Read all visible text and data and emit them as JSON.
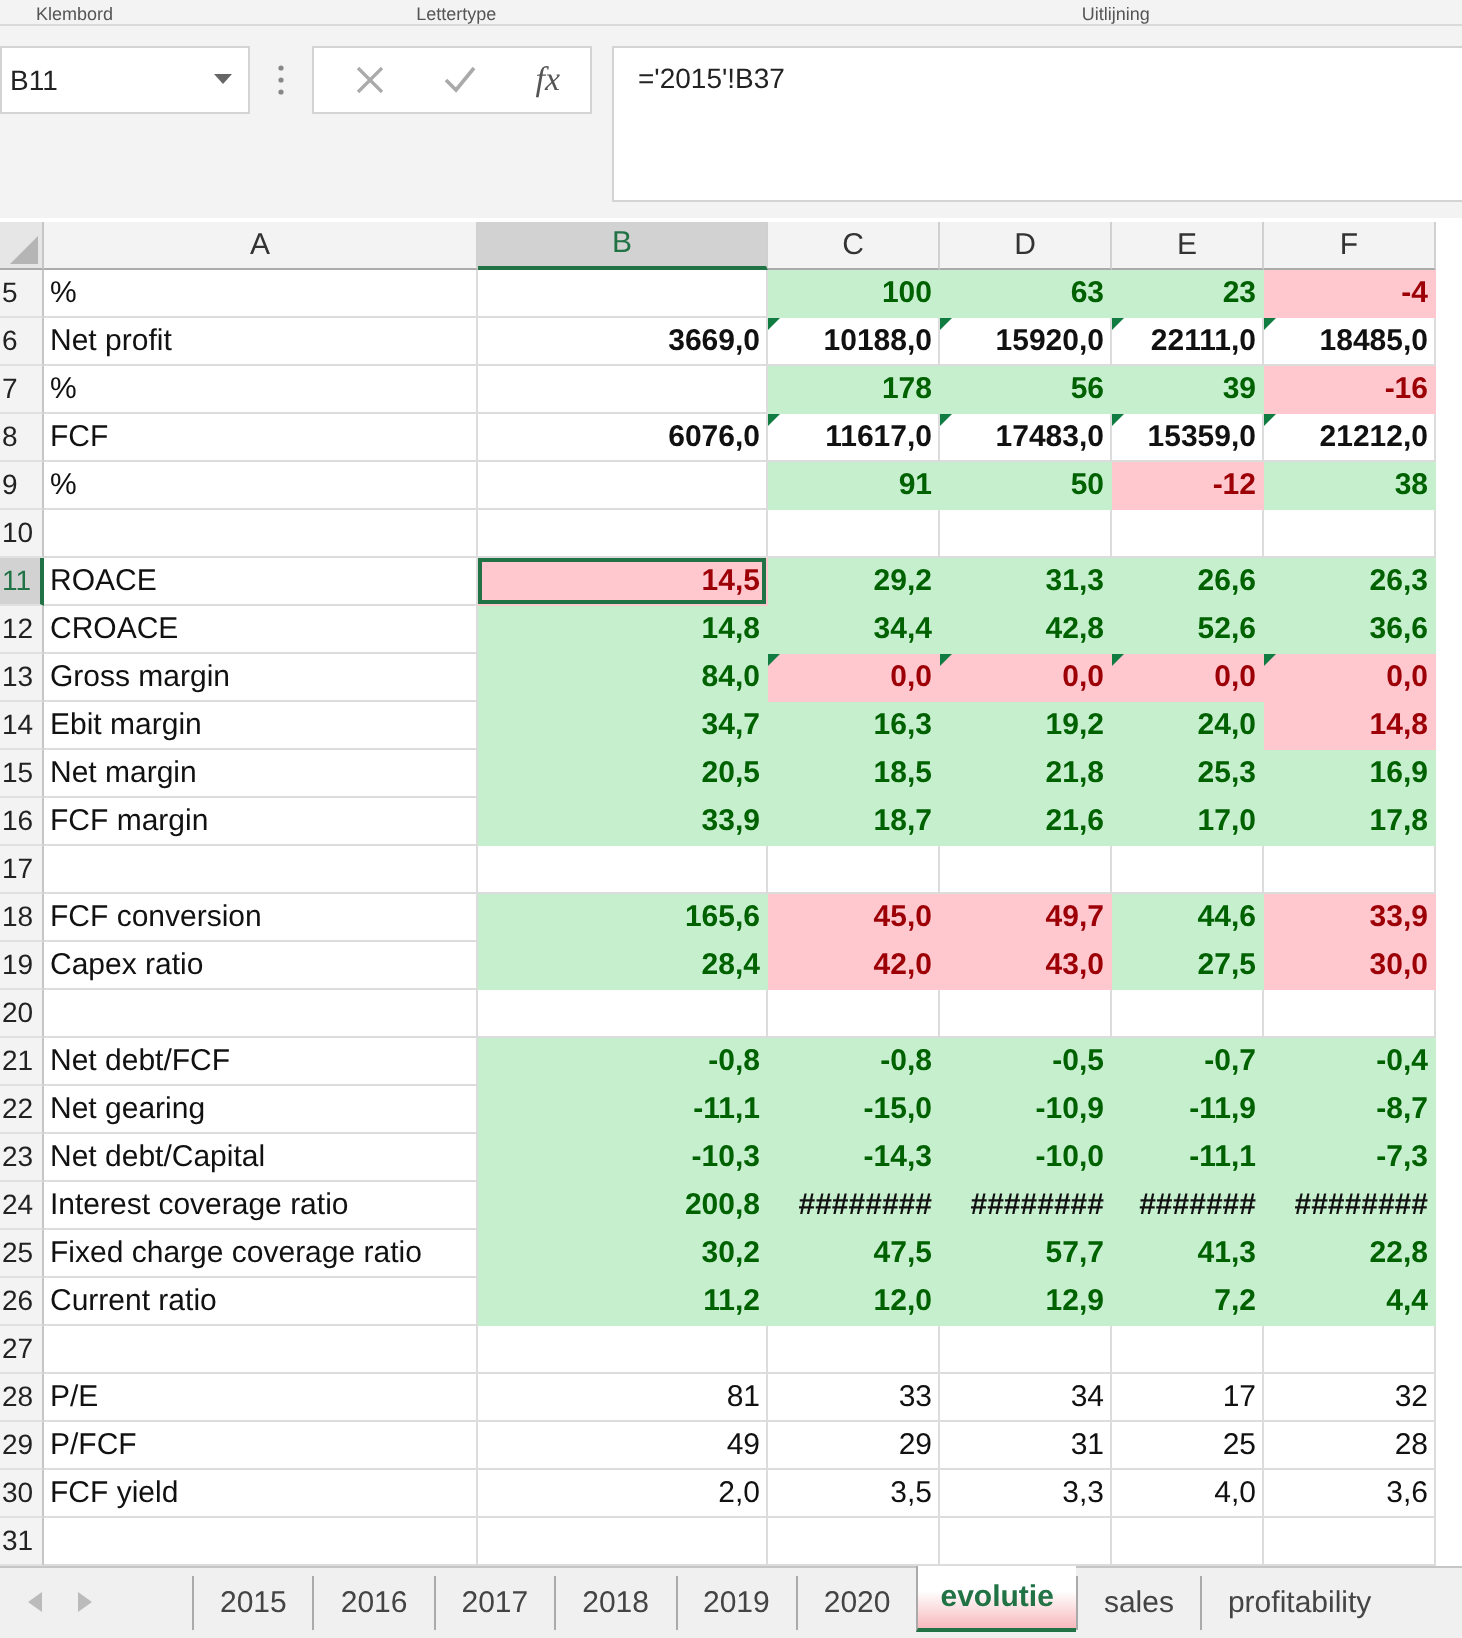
{
  "ribbon_groups": [
    "Klembord",
    "Lettertype",
    "Uitlijning"
  ],
  "formula_bar": {
    "name_box": "B11",
    "fx": "fx",
    "formula": "='2015'!B37"
  },
  "columns": [
    {
      "label": "A",
      "selected": false
    },
    {
      "label": "B",
      "selected": true
    },
    {
      "label": "C",
      "selected": false
    },
    {
      "label": "D",
      "selected": false
    },
    {
      "label": "E",
      "selected": false
    },
    {
      "label": "F",
      "selected": false
    }
  ],
  "rows": [
    {
      "num": "5",
      "label": "%",
      "selected": false,
      "bold": true,
      "cells": [
        null,
        {
          "text": "100",
          "kind": "good",
          "flag": false,
          "selected": false
        },
        {
          "text": "63",
          "kind": "good",
          "flag": false,
          "selected": false
        },
        {
          "text": "23",
          "kind": "good",
          "flag": false,
          "selected": false
        },
        {
          "text": "-4",
          "kind": "bad",
          "flag": false,
          "selected": false
        }
      ]
    },
    {
      "num": "6",
      "label": "Net profit",
      "selected": false,
      "bold": true,
      "cells": [
        {
          "text": "3669,0",
          "kind": "plain",
          "flag": false,
          "selected": false
        },
        {
          "text": "10188,0",
          "kind": "plain",
          "flag": true,
          "selected": false
        },
        {
          "text": "15920,0",
          "kind": "plain",
          "flag": true,
          "selected": false
        },
        {
          "text": "22111,0",
          "kind": "plain",
          "flag": true,
          "selected": false
        },
        {
          "text": "18485,0",
          "kind": "plain",
          "flag": true,
          "selected": false
        }
      ]
    },
    {
      "num": "7",
      "label": "%",
      "selected": false,
      "bold": true,
      "cells": [
        null,
        {
          "text": "178",
          "kind": "good",
          "flag": false,
          "selected": false
        },
        {
          "text": "56",
          "kind": "good",
          "flag": false,
          "selected": false
        },
        {
          "text": "39",
          "kind": "good",
          "flag": false,
          "selected": false
        },
        {
          "text": "-16",
          "kind": "bad",
          "flag": false,
          "selected": false
        }
      ]
    },
    {
      "num": "8",
      "label": "FCF",
      "selected": false,
      "bold": true,
      "cells": [
        {
          "text": "6076,0",
          "kind": "plain",
          "flag": false,
          "selected": false
        },
        {
          "text": "11617,0",
          "kind": "plain",
          "flag": true,
          "selected": false
        },
        {
          "text": "17483,0",
          "kind": "plain",
          "flag": true,
          "selected": false
        },
        {
          "text": "15359,0",
          "kind": "plain",
          "flag": true,
          "selected": false
        },
        {
          "text": "21212,0",
          "kind": "plain",
          "flag": true,
          "selected": false
        }
      ]
    },
    {
      "num": "9",
      "label": "%",
      "selected": false,
      "bold": true,
      "cells": [
        null,
        {
          "text": "91",
          "kind": "good",
          "flag": false,
          "selected": false
        },
        {
          "text": "50",
          "kind": "good",
          "flag": false,
          "selected": false
        },
        {
          "text": "-12",
          "kind": "bad",
          "flag": false,
          "selected": false
        },
        {
          "text": "38",
          "kind": "good",
          "flag": false,
          "selected": false
        }
      ]
    },
    {
      "num": "10",
      "label": "",
      "selected": false,
      "cells": []
    },
    {
      "num": "11",
      "label": "ROACE",
      "selected": true,
      "bold": true,
      "cells": [
        {
          "text": "14,5",
          "kind": "bad",
          "flag": false,
          "selected": true
        },
        {
          "text": "29,2",
          "kind": "good",
          "flag": false,
          "selected": false
        },
        {
          "text": "31,3",
          "kind": "good",
          "flag": false,
          "selected": false
        },
        {
          "text": "26,6",
          "kind": "good",
          "flag": false,
          "selected": false
        },
        {
          "text": "26,3",
          "kind": "good",
          "flag": false,
          "selected": false
        }
      ]
    },
    {
      "num": "12",
      "label": "CROACE",
      "selected": false,
      "bold": true,
      "cells": [
        {
          "text": "14,8",
          "kind": "good",
          "flag": false,
          "selected": false
        },
        {
          "text": "34,4",
          "kind": "good",
          "flag": false,
          "selected": false
        },
        {
          "text": "42,8",
          "kind": "good",
          "flag": false,
          "selected": false
        },
        {
          "text": "52,6",
          "kind": "good",
          "flag": false,
          "selected": false
        },
        {
          "text": "36,6",
          "kind": "good",
          "flag": false,
          "selected": false
        }
      ]
    },
    {
      "num": "13",
      "label": "Gross margin",
      "selected": false,
      "bold": true,
      "cells": [
        {
          "text": "84,0",
          "kind": "good",
          "flag": false,
          "selected": false
        },
        {
          "text": "0,0",
          "kind": "bad",
          "flag": true,
          "selected": false
        },
        {
          "text": "0,0",
          "kind": "bad",
          "flag": true,
          "selected": false
        },
        {
          "text": "0,0",
          "kind": "bad",
          "flag": true,
          "selected": false
        },
        {
          "text": "0,0",
          "kind": "bad",
          "flag": true,
          "selected": false
        }
      ]
    },
    {
      "num": "14",
      "label": "Ebit margin",
      "selected": false,
      "bold": true,
      "cells": [
        {
          "text": "34,7",
          "kind": "good",
          "flag": false,
          "selected": false
        },
        {
          "text": "16,3",
          "kind": "good",
          "flag": false,
          "selected": false
        },
        {
          "text": "19,2",
          "kind": "good",
          "flag": false,
          "selected": false
        },
        {
          "text": "24,0",
          "kind": "good",
          "flag": false,
          "selected": false
        },
        {
          "text": "14,8",
          "kind": "bad",
          "flag": false,
          "selected": false
        }
      ]
    },
    {
      "num": "15",
      "label": "Net margin",
      "selected": false,
      "bold": true,
      "cells": [
        {
          "text": "20,5",
          "kind": "good",
          "flag": false,
          "selected": false
        },
        {
          "text": "18,5",
          "kind": "good",
          "flag": false,
          "selected": false
        },
        {
          "text": "21,8",
          "kind": "good",
          "flag": false,
          "selected": false
        },
        {
          "text": "25,3",
          "kind": "good",
          "flag": false,
          "selected": false
        },
        {
          "text": "16,9",
          "kind": "good",
          "flag": false,
          "selected": false
        }
      ]
    },
    {
      "num": "16",
      "label": "FCF margin",
      "selected": false,
      "bold": true,
      "cells": [
        {
          "text": "33,9",
          "kind": "good",
          "flag": false,
          "selected": false
        },
        {
          "text": "18,7",
          "kind": "good",
          "flag": false,
          "selected": false
        },
        {
          "text": "21,6",
          "kind": "good",
          "flag": false,
          "selected": false
        },
        {
          "text": "17,0",
          "kind": "good",
          "flag": false,
          "selected": false
        },
        {
          "text": "17,8",
          "kind": "good",
          "flag": false,
          "selected": false
        }
      ]
    },
    {
      "num": "17",
      "label": "",
      "selected": false,
      "cells": []
    },
    {
      "num": "18",
      "label": "FCF conversion",
      "selected": false,
      "bold": true,
      "cells": [
        {
          "text": "165,6",
          "kind": "good",
          "flag": false,
          "selected": false
        },
        {
          "text": "45,0",
          "kind": "bad",
          "flag": false,
          "selected": false
        },
        {
          "text": "49,7",
          "kind": "bad",
          "flag": false,
          "selected": false
        },
        {
          "text": "44,6",
          "kind": "good",
          "flag": false,
          "selected": false
        },
        {
          "text": "33,9",
          "kind": "bad",
          "flag": false,
          "selected": false
        }
      ]
    },
    {
      "num": "19",
      "label": "Capex ratio",
      "selected": false,
      "bold": true,
      "cells": [
        {
          "text": "28,4",
          "kind": "good",
          "flag": false,
          "selected": false
        },
        {
          "text": "42,0",
          "kind": "bad",
          "flag": false,
          "selected": false
        },
        {
          "text": "43,0",
          "kind": "bad",
          "flag": false,
          "selected": false
        },
        {
          "text": "27,5",
          "kind": "good",
          "flag": false,
          "selected": false
        },
        {
          "text": "30,0",
          "kind": "bad",
          "flag": false,
          "selected": false
        }
      ]
    },
    {
      "num": "20",
      "label": "",
      "selected": false,
      "cells": []
    },
    {
      "num": "21",
      "label": "Net debt/FCF",
      "selected": false,
      "bold": true,
      "cells": [
        {
          "text": "-0,8",
          "kind": "good",
          "flag": false,
          "selected": false
        },
        {
          "text": "-0,8",
          "kind": "good",
          "flag": false,
          "selected": false
        },
        {
          "text": "-0,5",
          "kind": "good",
          "flag": false,
          "selected": false
        },
        {
          "text": "-0,7",
          "kind": "good",
          "flag": false,
          "selected": false
        },
        {
          "text": "-0,4",
          "kind": "good",
          "flag": false,
          "selected": false
        }
      ]
    },
    {
      "num": "22",
      "label": "Net gearing",
      "selected": false,
      "bold": true,
      "cells": [
        {
          "text": "-11,1",
          "kind": "good",
          "flag": false,
          "selected": false
        },
        {
          "text": "-15,0",
          "kind": "good",
          "flag": false,
          "selected": false
        },
        {
          "text": "-10,9",
          "kind": "good",
          "flag": false,
          "selected": false
        },
        {
          "text": "-11,9",
          "kind": "good",
          "flag": false,
          "selected": false
        },
        {
          "text": "-8,7",
          "kind": "good",
          "flag": false,
          "selected": false
        }
      ]
    },
    {
      "num": "23",
      "label": "Net debt/Capital",
      "selected": false,
      "bold": true,
      "cells": [
        {
          "text": "-10,3",
          "kind": "good",
          "flag": false,
          "selected": false
        },
        {
          "text": "-14,3",
          "kind": "good",
          "flag": false,
          "selected": false
        },
        {
          "text": "-10,0",
          "kind": "good",
          "flag": false,
          "selected": false
        },
        {
          "text": "-11,1",
          "kind": "good",
          "flag": false,
          "selected": false
        },
        {
          "text": "-7,3",
          "kind": "good",
          "flag": false,
          "selected": false
        }
      ]
    },
    {
      "num": "24",
      "label": "Interest coverage ratio",
      "selected": false,
      "bold": true,
      "cells": [
        {
          "text": "200,8",
          "kind": "good",
          "flag": false,
          "selected": false
        },
        {
          "text": "########",
          "kind": "overflow",
          "flag": false,
          "selected": false
        },
        {
          "text": "########",
          "kind": "overflow",
          "flag": false,
          "selected": false
        },
        {
          "text": "#######",
          "kind": "overflow",
          "flag": false,
          "selected": false
        },
        {
          "text": "########",
          "kind": "overflow",
          "flag": false,
          "selected": false
        }
      ]
    },
    {
      "num": "25",
      "label": "Fixed charge coverage ratio",
      "selected": false,
      "bold": true,
      "cells": [
        {
          "text": "30,2",
          "kind": "good",
          "flag": false,
          "selected": false
        },
        {
          "text": "47,5",
          "kind": "good",
          "flag": false,
          "selected": false
        },
        {
          "text": "57,7",
          "kind": "good",
          "flag": false,
          "selected": false
        },
        {
          "text": "41,3",
          "kind": "good",
          "flag": false,
          "selected": false
        },
        {
          "text": "22,8",
          "kind": "good",
          "flag": false,
          "selected": false
        }
      ]
    },
    {
      "num": "26",
      "label": "Current ratio",
      "selected": false,
      "bold": true,
      "cells": [
        {
          "text": "11,2",
          "kind": "good",
          "flag": false,
          "selected": false
        },
        {
          "text": "12,0",
          "kind": "good",
          "flag": false,
          "selected": false
        },
        {
          "text": "12,9",
          "kind": "good",
          "flag": false,
          "selected": false
        },
        {
          "text": "7,2",
          "kind": "good",
          "flag": false,
          "selected": false
        },
        {
          "text": "4,4",
          "kind": "good",
          "flag": false,
          "selected": false
        }
      ]
    },
    {
      "num": "27",
      "label": "",
      "selected": false,
      "cells": []
    },
    {
      "num": "28",
      "label": "P/E",
      "selected": false,
      "bold": false,
      "cells": [
        {
          "text": "81",
          "kind": "plain",
          "flag": false,
          "selected": false
        },
        {
          "text": "33",
          "kind": "plain",
          "flag": false,
          "selected": false
        },
        {
          "text": "34",
          "kind": "plain",
          "flag": false,
          "selected": false
        },
        {
          "text": "17",
          "kind": "plain",
          "flag": false,
          "selected": false
        },
        {
          "text": "32",
          "kind": "plain",
          "flag": false,
          "selected": false
        }
      ]
    },
    {
      "num": "29",
      "label": "P/FCF",
      "selected": false,
      "bold": false,
      "cells": [
        {
          "text": "49",
          "kind": "plain",
          "flag": false,
          "selected": false
        },
        {
          "text": "29",
          "kind": "plain",
          "flag": false,
          "selected": false
        },
        {
          "text": "31",
          "kind": "plain",
          "flag": false,
          "selected": false
        },
        {
          "text": "25",
          "kind": "plain",
          "flag": false,
          "selected": false
        },
        {
          "text": "28",
          "kind": "plain",
          "flag": false,
          "selected": false
        }
      ]
    },
    {
      "num": "30",
      "label": "FCF yield",
      "selected": false,
      "bold": false,
      "cells": [
        {
          "text": "2,0",
          "kind": "plain",
          "flag": false,
          "selected": false
        },
        {
          "text": "3,5",
          "kind": "plain",
          "flag": false,
          "selected": false
        },
        {
          "text": "3,3",
          "kind": "plain",
          "flag": false,
          "selected": false
        },
        {
          "text": "4,0",
          "kind": "plain",
          "flag": false,
          "selected": false
        },
        {
          "text": "3,6",
          "kind": "plain",
          "flag": false,
          "selected": false
        }
      ]
    },
    {
      "num": "31",
      "label": "",
      "selected": false,
      "cells": []
    }
  ],
  "sheet_tabs": [
    {
      "label": "2015",
      "selected": false
    },
    {
      "label": "2016",
      "selected": false
    },
    {
      "label": "2017",
      "selected": false
    },
    {
      "label": "2018",
      "selected": false
    },
    {
      "label": "2019",
      "selected": false
    },
    {
      "label": "2020",
      "selected": false
    },
    {
      "label": "evolutie",
      "selected": true
    },
    {
      "label": "sales",
      "selected": false
    },
    {
      "label": "profitability",
      "selected": false
    }
  ]
}
